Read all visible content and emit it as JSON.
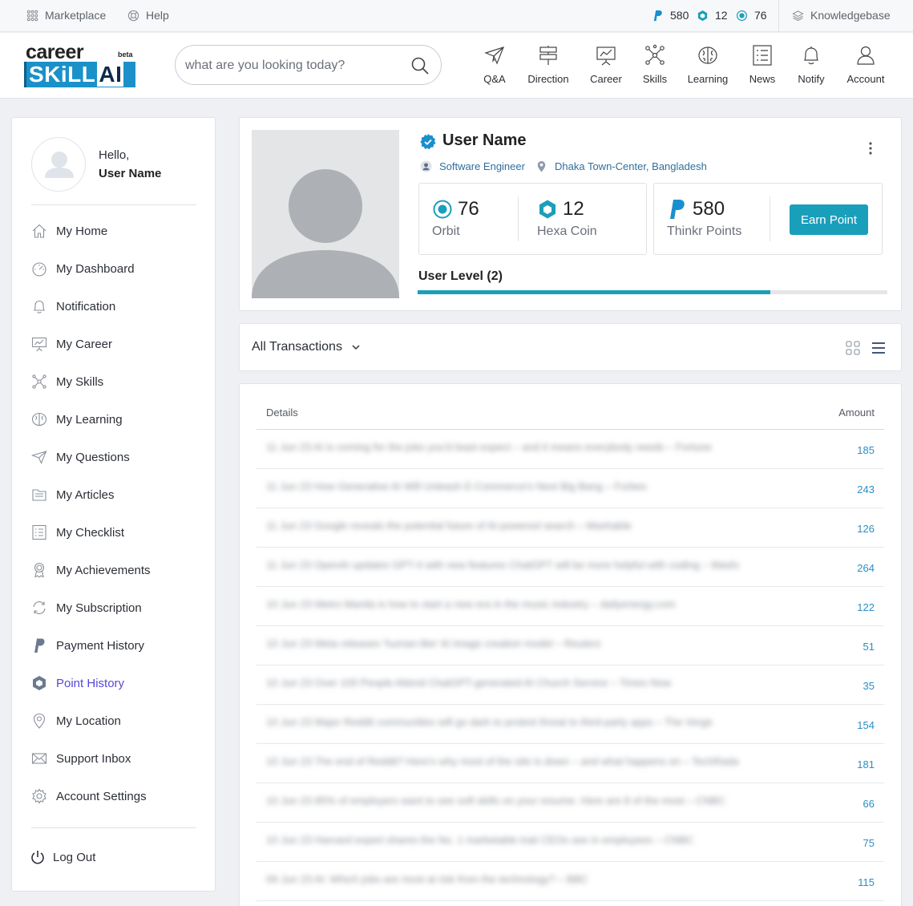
{
  "topbar": {
    "marketplace": "Marketplace",
    "help": "Help",
    "points": "580",
    "hexa": "12",
    "orbit": "76",
    "knowledgebase": "Knowledgebase"
  },
  "logo": {
    "top": "career",
    "beta": "beta",
    "skill": "SKiLL",
    "ai": "AI"
  },
  "search": {
    "placeholder": "what are you looking today?"
  },
  "nav": {
    "qa": "Q&A",
    "direction": "Direction",
    "career": "Career",
    "skills": "Skills",
    "learning": "Learning",
    "news": "News",
    "notify": "Notify",
    "account": "Account"
  },
  "sidebar": {
    "hello": "Hello,",
    "user_name": "User Name",
    "items": [
      "My Home",
      "My Dashboard",
      "Notification",
      "My Career",
      "My Skills",
      "My Learning",
      "My Questions",
      "My Articles",
      "My Checklist",
      "My Achievements",
      "My Subscription",
      "Payment History",
      "Point History",
      "My Location",
      "Support Inbox",
      "Account Settings"
    ],
    "logout": "Log Out"
  },
  "profile": {
    "name": "User Name",
    "title": "Software Engineer",
    "location": "Dhaka Town-Center, Bangladesh",
    "orbit_value": "76",
    "orbit_label": "Orbit",
    "hexa_value": "12",
    "hexa_label": "Hexa Coin",
    "points_value": "580",
    "points_label": "Thinkr Points",
    "earn_label": "Earn Point",
    "level_label": "User Level (2)",
    "level_progress": 0.75
  },
  "filter": {
    "label": "All Transactions"
  },
  "table": {
    "col_details": "Details",
    "col_amount": "Amount",
    "rows": [
      {
        "details": "11 Jun 23 AI is coming for the jobs you'd least expect – and it means everybody needs – Fortune",
        "amount": "185"
      },
      {
        "details": "11 Jun 23 How Generative AI Will Unleash E-Commerce's Next Big Bang – Forbes",
        "amount": "243"
      },
      {
        "details": "11 Jun 23 Google reveals the potential future of AI-powered search – Mashable",
        "amount": "126"
      },
      {
        "details": "11 Jun 23 OpenAI updates GPT-4 with new features ChatGPT will be more helpful with coding – Mashable",
        "amount": "264"
      },
      {
        "details": "10 Jun 23 Metro Manila is how to start a new era in the music industry – dailyenergy.com",
        "amount": "122"
      },
      {
        "details": "10 Jun 23 Meta releases 'human-like' AI image creation model – Reuters",
        "amount": "51"
      },
      {
        "details": "10 Jun 23 Over 100 People Attend ChatGPT-generated AI Church Service – Times Now",
        "amount": "35"
      },
      {
        "details": "10 Jun 23 Major Reddit communities will go dark to protest threat to third-party apps – The Verge",
        "amount": "154"
      },
      {
        "details": "10 Jun 23 The end of Reddit? Here's why most of the site is down – and what happens on – TechRadar",
        "amount": "181"
      },
      {
        "details": "10 Jun 23 85% of employers want to see soft skills on your resume. Here are 8 of the most – CNBC",
        "amount": "66"
      },
      {
        "details": "10 Jun 23 Harvard expert shares the No. 1 marketable trait CEOs see in employees – CNBC",
        "amount": "75"
      },
      {
        "details": "09 Jun 23 AI: Which jobs are most at risk from the technology? – BBC",
        "amount": "115"
      }
    ]
  }
}
